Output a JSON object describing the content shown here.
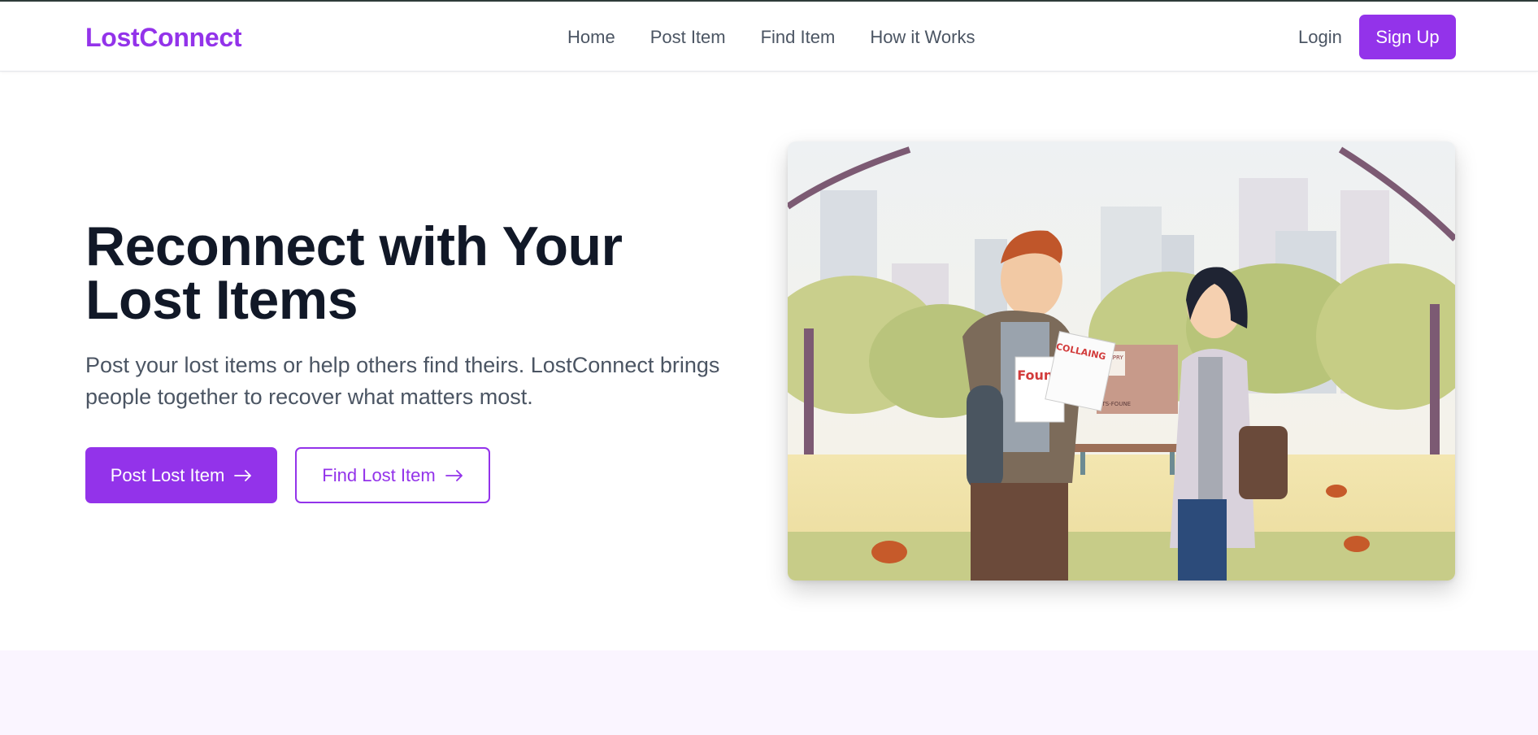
{
  "brand": {
    "name": "LostConnect",
    "color": "#9333ea"
  },
  "nav": {
    "links": [
      {
        "label": "Home"
      },
      {
        "label": "Post Item"
      },
      {
        "label": "Find Item"
      },
      {
        "label": "How it Works"
      }
    ],
    "login_label": "Login",
    "signup_label": "Sign Up"
  },
  "hero": {
    "title": "Reconnect with Your Lost Items",
    "subtitle": "Post your lost items or help others find theirs. LostConnect brings people together to recover what matters most.",
    "primary_cta": {
      "label": "Post Lost Item",
      "icon": "arrow-right-icon"
    },
    "secondary_cta": {
      "label": "Find Lost Item",
      "icon": "arrow-right-icon"
    },
    "image": {
      "poster_found_text": "Found",
      "poster_collaing_text": "COLLAING",
      "board_top_text": "TAPRY",
      "board_bottom_text": "PETS-FOUNE"
    }
  },
  "colors": {
    "accent": "#9333ea",
    "heading": "#111827",
    "body_text": "#4b5563",
    "section_bg": "#faf5ff"
  }
}
